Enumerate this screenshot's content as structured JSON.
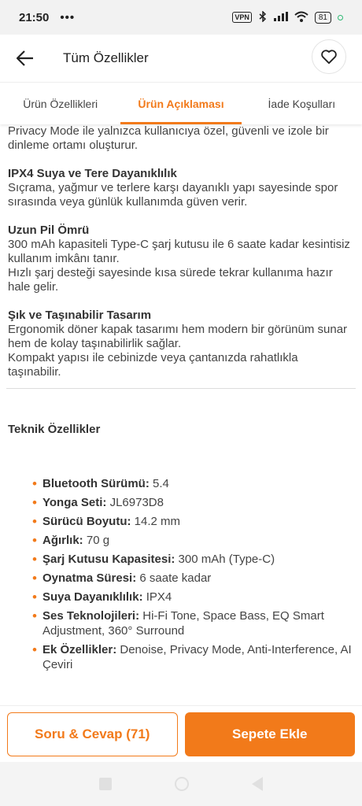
{
  "status_bar": {
    "time": "21:50",
    "dots": "•••",
    "vpn": "VPN",
    "battery": "81"
  },
  "header": {
    "title": "Tüm Özellikler"
  },
  "tabs": [
    {
      "label": "Ürün Özellikleri",
      "active": false
    },
    {
      "label": "Ürün Açıklaması",
      "active": true
    },
    {
      "label": "İade Koşulları",
      "active": false
    }
  ],
  "content": {
    "intro": "Privacy Mode ile yalnızca kullanıcıya özel, güvenli ve izole bir dinleme ortamı oluşturur.",
    "sections": [
      {
        "title": "IPX4 Suya ve Tere Dayanıklılık",
        "lines": [
          "Sıçrama, yağmur ve terlere karşı dayanıklı yapı sayesinde spor sırasında veya günlük kullanımda güven verir."
        ]
      },
      {
        "title": "Uzun Pil Ömrü",
        "lines": [
          "300 mAh kapasiteli Type-C şarj kutusu ile 6 saate kadar kesintisiz kullanım imkânı tanır.",
          "Hızlı şarj desteği sayesinde kısa sürede tekrar kullanıma hazır hale gelir."
        ]
      },
      {
        "title": "Şık ve Taşınabilir Tasarım",
        "lines": [
          "Ergonomik döner kapak tasarımı hem modern bir görünüm sunar hem de kolay taşınabilirlik sağlar.",
          "Kompakt yapısı ile cebinizde veya çantanızda rahatlıkla taşınabilir."
        ]
      }
    ],
    "spec_title": "Teknik Özellikler",
    "specs": [
      {
        "key": "Bluetooth Sürümü:",
        "value": " 5.4"
      },
      {
        "key": "Yonga Seti:",
        "value": " JL6973D8"
      },
      {
        "key": "Sürücü Boyutu:",
        "value": " 14.2 mm"
      },
      {
        "key": "Ağırlık:",
        "value": " 70 g"
      },
      {
        "key": "Şarj Kutusu Kapasitesi:",
        "value": " 300 mAh (Type-C)"
      },
      {
        "key": "Oynatma Süresi:",
        "value": " 6 saate kadar"
      },
      {
        "key": "Suya Dayanıklılık:",
        "value": " IPX4"
      },
      {
        "key": " Ses Teknolojileri:",
        "value": " Hi-Fi Tone, Space Bass, EQ Smart Adjustment, 360° Surround"
      },
      {
        "key": " Ek Özellikler:",
        "value": " Denoise, Privacy Mode, Anti-Interference, AI Çeviri"
      }
    ]
  },
  "bottom_bar": {
    "qa_label": "Soru & Cevap (71)",
    "cart_label": "Sepete Ekle"
  },
  "colors": {
    "accent": "#f27a1a"
  }
}
